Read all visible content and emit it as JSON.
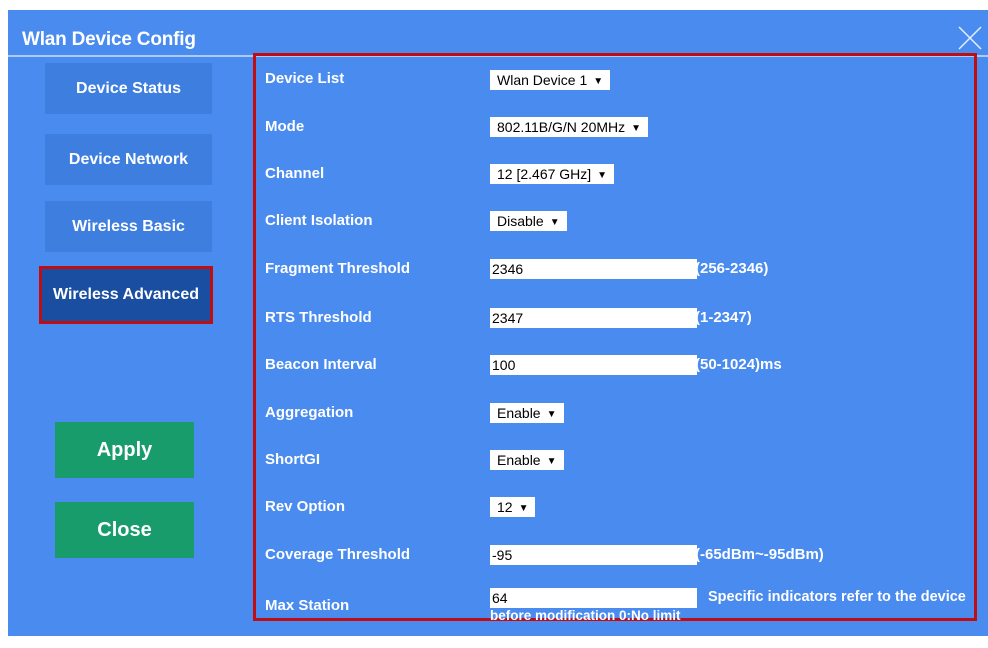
{
  "window": {
    "title": "Wlan Device Config"
  },
  "sidebar": {
    "items": [
      {
        "label": "Device Status"
      },
      {
        "label": "Device Network"
      },
      {
        "label": "Wireless Basic"
      },
      {
        "label": "Wireless Advanced",
        "active": true
      }
    ],
    "apply_label": "Apply",
    "close_label": "Close"
  },
  "form": {
    "device_list": {
      "label": "Device List",
      "value": "Wlan Device 1"
    },
    "mode": {
      "label": "Mode",
      "value": "802.11B/G/N 20MHz"
    },
    "channel": {
      "label": "Channel",
      "value": "12 [2.467 GHz]"
    },
    "client_isolation": {
      "label": "Client Isolation",
      "value": "Disable"
    },
    "fragment_threshold": {
      "label": "Fragment Threshold",
      "value": "2346",
      "range": "(256-2346)"
    },
    "rts_threshold": {
      "label": "RTS Threshold",
      "value": "2347",
      "range": "(1-2347)"
    },
    "beacon_interval": {
      "label": "Beacon Interval",
      "value": "100",
      "range": "(50-1024)ms"
    },
    "aggregation": {
      "label": "Aggregation",
      "value": "Enable"
    },
    "shortgi": {
      "label": "ShortGI",
      "value": "Enable"
    },
    "rev_option": {
      "label": "Rev Option",
      "value": "12"
    },
    "coverage_threshold": {
      "label": "Coverage Threshold",
      "value": "-95",
      "range": "(-65dBm~-95dBm)"
    },
    "max_station": {
      "label": "Max Station",
      "value": "64",
      "note": "Specific indicators refer to the device",
      "note2": "before modification 0:No limit"
    }
  },
  "colors": {
    "background": "#4a8bef",
    "nav_button": "#3d7edf",
    "nav_active": "#1a4ea0",
    "highlight_border": "#c00d12",
    "action_button": "#199c6c"
  },
  "icons": {
    "close": "close-x-icon",
    "dropdown": "triangle-down-icon"
  }
}
